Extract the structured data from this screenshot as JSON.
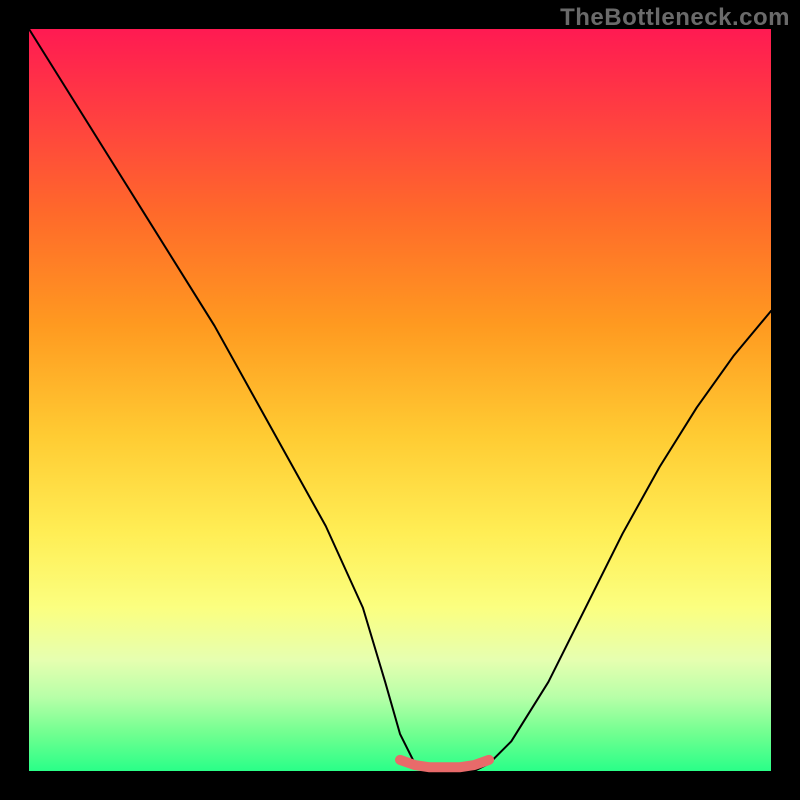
{
  "watermark": "TheBottleneck.com",
  "colors": {
    "curve": "#000000",
    "marker": "#e86a6a",
    "background_frame": "#000000"
  },
  "chart_data": {
    "type": "line",
    "title": "",
    "xlabel": "",
    "ylabel": "",
    "xlim": [
      0,
      100
    ],
    "ylim": [
      0,
      100
    ],
    "grid": false,
    "legend": false,
    "series": [
      {
        "name": "bottleneck-curve",
        "x": [
          0,
          5,
          10,
          15,
          20,
          25,
          30,
          35,
          40,
          45,
          48,
          50,
          52,
          55,
          58,
          60,
          62,
          65,
          70,
          75,
          80,
          85,
          90,
          95,
          100
        ],
        "y": [
          100,
          92,
          84,
          76,
          68,
          60,
          51,
          42,
          33,
          22,
          12,
          5,
          1,
          0,
          0,
          0,
          1,
          4,
          12,
          22,
          32,
          41,
          49,
          56,
          62
        ]
      },
      {
        "name": "valley-marker",
        "x": [
          50,
          52,
          54,
          56,
          58,
          60,
          62
        ],
        "y": [
          1.5,
          0.8,
          0.5,
          0.5,
          0.5,
          0.8,
          1.5
        ]
      }
    ]
  }
}
